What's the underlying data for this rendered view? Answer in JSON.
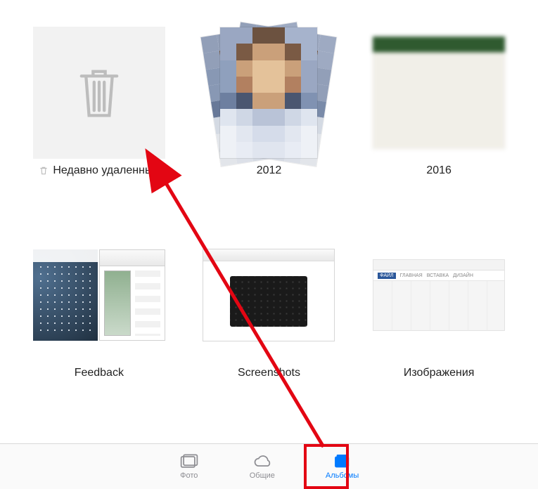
{
  "albums": [
    {
      "id": "recently-deleted",
      "label": "Недавно удаленные",
      "has_trash_prefix_icon": true
    },
    {
      "id": "2012",
      "label": "2012"
    },
    {
      "id": "2016",
      "label": "2016"
    },
    {
      "id": "feedback",
      "label": "Feedback"
    },
    {
      "id": "screenshots",
      "label": "Screenshots"
    },
    {
      "id": "images",
      "label": "Изображения"
    }
  ],
  "tabbar": {
    "photos": "Фото",
    "shared": "Общие",
    "albums": "Альбомы",
    "active": "albums"
  },
  "annotation": {
    "kind": "tutorial-arrow",
    "from": "tabbar.albums",
    "to": "albums.recently-deleted",
    "color": "#e30613"
  }
}
